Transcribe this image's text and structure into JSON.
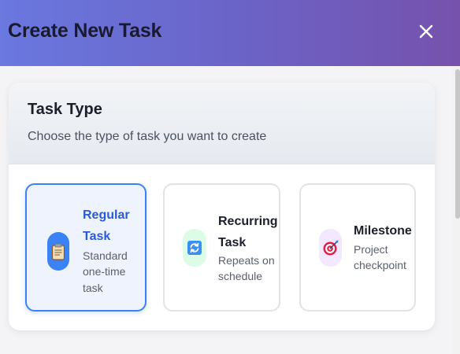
{
  "header": {
    "title": "Create New Task",
    "close_icon": "close-icon"
  },
  "task_type": {
    "title": "Task Type",
    "subtitle": "Choose the type of task you want to create",
    "options": [
      {
        "title_line1": "Regular",
        "title_line2": "Task",
        "desc_line1": "Standard",
        "desc_line2": "one-time",
        "desc_line3": "task",
        "icon": "clipboard-icon",
        "selected": true
      },
      {
        "title_line1": "Recurring",
        "title_line2": "Task",
        "desc_line1": "Repeats on",
        "desc_line2": "schedule",
        "icon": "repeat-icon",
        "selected": false
      },
      {
        "title_line1": "Milestone",
        "desc_line1": "Project",
        "desc_line2": "checkpoint",
        "icon": "target-icon",
        "selected": false
      }
    ]
  },
  "colors": {
    "header_gradient_start": "#6a78df",
    "header_gradient_end": "#7652ac",
    "selected_border": "#3b82f6",
    "selected_title": "#2a5bd7"
  }
}
